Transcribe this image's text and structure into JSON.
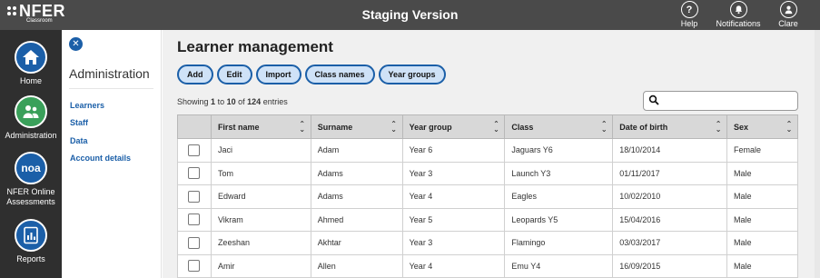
{
  "header": {
    "logo_text": "NFER",
    "logo_sub": "Classroom",
    "title": "Staging Version",
    "items": [
      {
        "label": "Help",
        "icon": "help-icon"
      },
      {
        "label": "Notifications",
        "icon": "bell-icon"
      },
      {
        "label": "Clare",
        "icon": "user-icon"
      }
    ]
  },
  "rail": {
    "items": [
      {
        "label": "Home",
        "icon": "home-icon"
      },
      {
        "label": "Administration",
        "icon": "people-icon",
        "active": true
      },
      {
        "label_1": "NFER Online",
        "label_2": "Assessments",
        "icon": "noa-icon",
        "icon_text": "noa"
      },
      {
        "label": "Reports",
        "icon": "report-icon"
      }
    ]
  },
  "panel": {
    "title": "Administration",
    "links": [
      "Learners",
      "Staff",
      "Data",
      "Account details"
    ]
  },
  "main": {
    "title": "Learner management",
    "buttons": [
      "Add",
      "Edit",
      "Import",
      "Class names",
      "Year groups"
    ],
    "showing": {
      "prefix": "Showing",
      "from": "1",
      "to_word": "to",
      "to": "10",
      "of_word": "of",
      "total": "124",
      "suffix": "entries"
    },
    "search_placeholder": ""
  },
  "table": {
    "columns": [
      "First name",
      "Surname",
      "Year group",
      "Class",
      "Date of birth",
      "Sex"
    ],
    "rows": [
      [
        "Jaci",
        "Adam",
        "Year 6",
        "Jaguars Y6",
        "18/10/2014",
        "Female"
      ],
      [
        "Tom",
        "Adams",
        "Year 3",
        "Launch Y3",
        "01/11/2017",
        "Male"
      ],
      [
        "Edward",
        "Adams",
        "Year 4",
        "Eagles",
        "10/02/2010",
        "Male"
      ],
      [
        "Vikram",
        "Ahmed",
        "Year 5",
        "Leopards Y5",
        "15/04/2016",
        "Male"
      ],
      [
        "Zeeshan",
        "Akhtar",
        "Year 3",
        "Flamingo",
        "03/03/2017",
        "Male"
      ],
      [
        "Amir",
        "Allen",
        "Year 4",
        "Emu Y4",
        "16/09/2015",
        "Male"
      ]
    ]
  },
  "colors": {
    "topbar": "#4a4a4a",
    "rail": "#2f2f2f",
    "brand_blue": "#1b5fa8",
    "active_green": "#3aa05a",
    "button_fill": "#cfe2f7"
  }
}
